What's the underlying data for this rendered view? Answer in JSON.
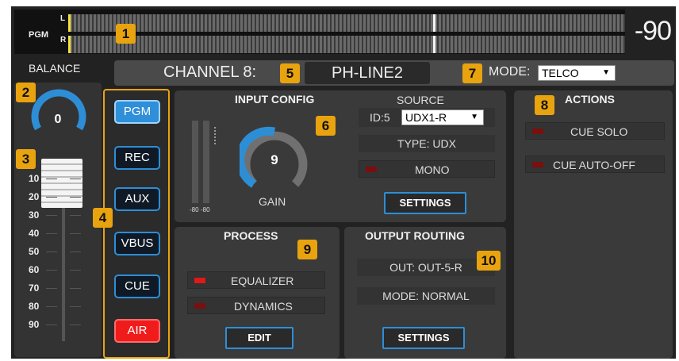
{
  "meter": {
    "pgm_label": "PGM",
    "left_label": "L",
    "right_label": "R",
    "readout": "-90",
    "badge": "1"
  },
  "balance": {
    "label": "BALANCE",
    "value": "0",
    "badge": "2",
    "fader_badge": "3",
    "scale": [
      "10",
      "20",
      "30",
      "40",
      "50",
      "60",
      "70",
      "80",
      "90"
    ]
  },
  "bus": {
    "badge": "4",
    "buttons": [
      {
        "label": "PGM",
        "state": "active"
      },
      {
        "label": "REC",
        "state": "off"
      },
      {
        "label": "AUX",
        "state": "off"
      },
      {
        "label": "VBUS",
        "state": "active"
      },
      {
        "label": "CUE",
        "state": "off"
      },
      {
        "label": "AIR",
        "state": "air"
      }
    ]
  },
  "channel": {
    "label": "CHANNEL 8:",
    "badge": "5",
    "name": "PH-LINE2",
    "mode_label": "MODE:",
    "mode_badge": "7",
    "mode_value": "TELCO"
  },
  "input_config": {
    "title": "INPUT CONFIG",
    "badge": "6",
    "meter_labels": [
      "-80",
      "-80"
    ],
    "gain_value": "9",
    "gain_label": "GAIN",
    "source_title": "SOURCE",
    "id_label": "ID:5",
    "source_value": "UDX1-R",
    "type": "TYPE: UDX",
    "mono": "MONO",
    "settings": "SETTINGS"
  },
  "actions": {
    "title": "ACTIONS",
    "badge": "8",
    "items": [
      "CUE SOLO",
      "CUE AUTO-OFF"
    ]
  },
  "process": {
    "title": "PROCESS",
    "badge": "9",
    "items": [
      {
        "label": "EQUALIZER",
        "on": true
      },
      {
        "label": "DYNAMICS",
        "on": false
      }
    ],
    "edit": "EDIT"
  },
  "output_routing": {
    "title": "OUTPUT ROUTING",
    "badge": "10",
    "out": "OUT: OUT-5-R",
    "mode": "MODE: NORMAL",
    "settings": "SETTINGS"
  },
  "colors": {
    "accent_blue": "#2d8ed6",
    "badge_orange": "#e8a30f",
    "led_red": "#e01818",
    "air_red": "#f01c1c"
  }
}
